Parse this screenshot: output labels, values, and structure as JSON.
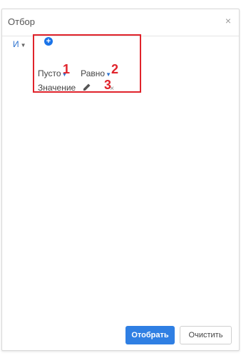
{
  "dialog": {
    "title": "Отбор",
    "close_symbol": "×"
  },
  "filter": {
    "logic_label": "И",
    "add_icon": "plus-circle-icon",
    "condition": {
      "field_label": "Пусто",
      "operator_label": "Равно",
      "value_label": "Значение",
      "remove_symbol": "×"
    }
  },
  "annotations": {
    "mark1": "1",
    "mark2": "2",
    "mark3": "3",
    "color": "#e0232b"
  },
  "footer": {
    "apply_label": "Отобрать",
    "clear_label": "Очистить"
  },
  "colors": {
    "accent": "#2f7fe3",
    "link": "#2f74d0"
  }
}
